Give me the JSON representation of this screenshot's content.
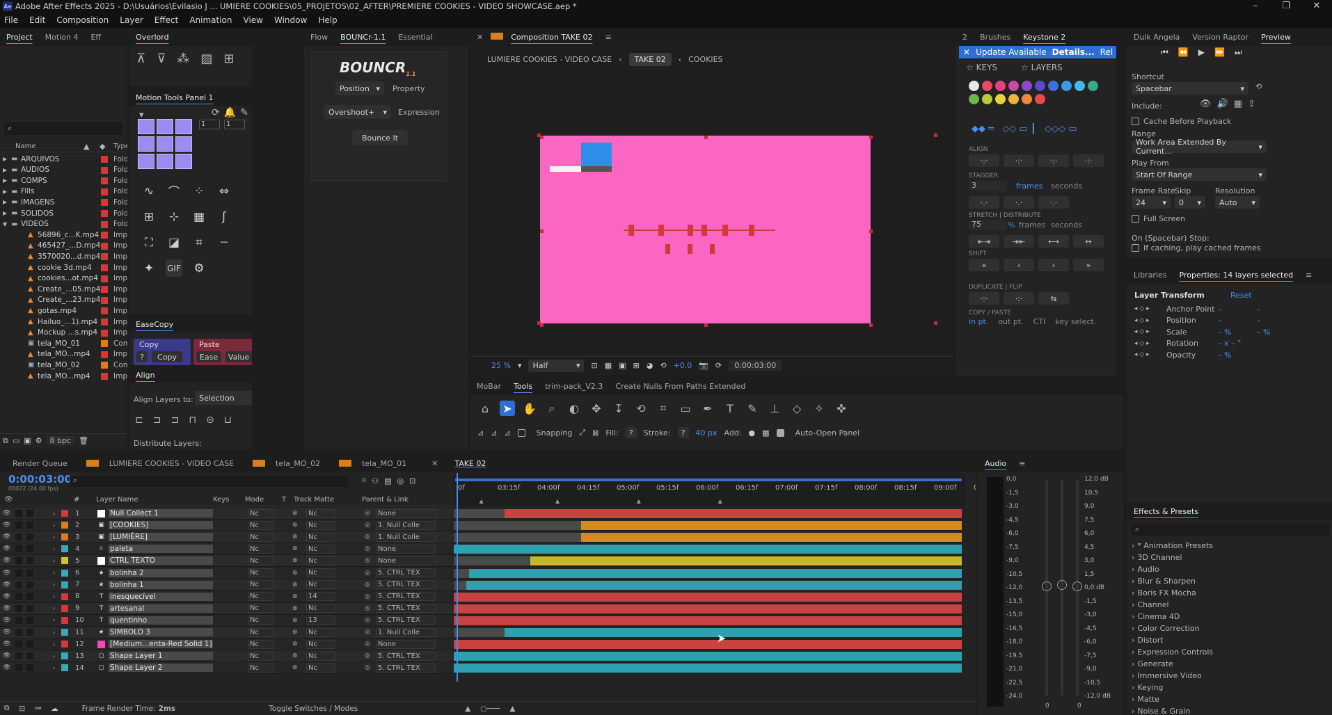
{
  "window": {
    "title": "Adobe After Effects 2025 - D:\\Usuários\\Evilasio J ... UMIERE COOKIES\\05_PROJETOS\\02_AFTER\\PREMIERE COOKIES - VIDEO SHOWCASE.aep *",
    "logo": "Ae"
  },
  "menu": [
    "File",
    "Edit",
    "Composition",
    "Layer",
    "Effect",
    "Animation",
    "View",
    "Window",
    "Help"
  ],
  "project": {
    "tabs": [
      "Project",
      "Motion 4",
      "Eff"
    ],
    "search_placeholder": "",
    "col_name": "Name",
    "col_type": "Type",
    "items": [
      {
        "name": "ARQUIVOS",
        "type": "Folder",
        "color": "#d23a3a",
        "icon": "folder-icon",
        "arrow": "▶"
      },
      {
        "name": "AUDIOS",
        "type": "Folder",
        "color": "#d23a3a",
        "icon": "folder-icon",
        "arrow": "▶"
      },
      {
        "name": "COMPS",
        "type": "Folder",
        "color": "#d23a3a",
        "icon": "folder-icon",
        "arrow": "▶"
      },
      {
        "name": "Fills",
        "type": "Folder",
        "color": "#d23a3a",
        "icon": "folder-icon",
        "arrow": "▶"
      },
      {
        "name": "IMAGENS",
        "type": "Folder",
        "color": "#d23a3a",
        "icon": "folder-icon",
        "arrow": "▶"
      },
      {
        "name": "SOLIDOS",
        "type": "Folder",
        "color": "#d23a3a",
        "icon": "folder-icon",
        "arrow": "▶"
      },
      {
        "name": "VIDEOS",
        "type": "Folder",
        "color": "#d23a3a",
        "icon": "folder-icon",
        "arrow": "▼"
      },
      {
        "name": "56896_c...K.mp4",
        "type": "Importe",
        "color": "#d23a3a",
        "icon": "cone-icon",
        "arrow": ""
      },
      {
        "name": "465427_...D.mp4",
        "type": "Importe",
        "color": "#d23a3a",
        "icon": "cone-icon",
        "arrow": ""
      },
      {
        "name": "3570020...d.mp4",
        "type": "Importe",
        "color": "#d23a3a",
        "icon": "cone-icon",
        "arrow": ""
      },
      {
        "name": "cookie 3d.mp4",
        "type": "Importe",
        "color": "#d23a3a",
        "icon": "cone-icon",
        "arrow": ""
      },
      {
        "name": "cookies...ot.mp4",
        "type": "Importe",
        "color": "#d23a3a",
        "icon": "cone-icon",
        "arrow": ""
      },
      {
        "name": "Create_...05.mp4",
        "type": "Importe",
        "color": "#d23a3a",
        "icon": "cone-icon",
        "arrow": ""
      },
      {
        "name": "Create_...23.mp4",
        "type": "Importe",
        "color": "#d23a3a",
        "icon": "cone-icon",
        "arrow": ""
      },
      {
        "name": "gotas.mp4",
        "type": "Importe",
        "color": "#d23a3a",
        "icon": "cone-icon",
        "arrow": ""
      },
      {
        "name": "Hailuo_...1).mp4",
        "type": "Importe",
        "color": "#d23a3a",
        "icon": "cone-icon",
        "arrow": ""
      },
      {
        "name": "Mockup ...s.mp4",
        "type": "Importe",
        "color": "#d23a3a",
        "icon": "cone-icon",
        "arrow": ""
      },
      {
        "name": "tela_MO_01",
        "type": "Compos",
        "color": "#d97e1a",
        "icon": "comp-icon",
        "arrow": ""
      },
      {
        "name": "tela_MO...mp4",
        "type": "Importe",
        "color": "#d23a3a",
        "icon": "cone-icon",
        "arrow": ""
      },
      {
        "name": "tela_MO_02",
        "type": "Compos",
        "color": "#d97e1a",
        "icon": "comp-icon",
        "arrow": ""
      },
      {
        "name": "tela_MO...mp4",
        "type": "Importe",
        "color": "#d23a3a",
        "icon": "cone-icon",
        "arrow": ""
      }
    ],
    "bpc": "8 bpc"
  },
  "overlord": {
    "title": "Overlord"
  },
  "motion_tools": {
    "title": "Motion Tools Panel 1",
    "num1": "1",
    "num2": "1",
    "gif": "GIF"
  },
  "easecopy": {
    "title": "EaseCopy",
    "copy": "Copy",
    "paste": "Paste",
    "q": "?",
    "copy_btn": "Copy",
    "ease": "Ease",
    "value": "Value"
  },
  "align": {
    "title": "Align",
    "align_to_label": "Align Layers to:",
    "align_to_value": "Selection",
    "distribute": "Distribute Layers:"
  },
  "bounce": {
    "tabs": [
      "Flow",
      "BOUNCr-1.1",
      "Essential"
    ],
    "logo": "BOUNCR",
    "logo_sub": "1.1",
    "position": "Position",
    "property": "Property",
    "overshoot": "Overshoot+",
    "expression": "Expression",
    "bounce_btn": "Bounce It"
  },
  "composition": {
    "tab": "Composition TAKE 02",
    "crumbs": [
      "LUMIERE COOKIES - VIDEO CASE",
      "TAKE 02",
      "COOKIES"
    ],
    "zoom": "25 %",
    "res": "Half",
    "exposure": "+0,0",
    "time": "0:00:03:00",
    "bg": "#fc66c3"
  },
  "keystone": {
    "tabs": [
      "2",
      "Brushes",
      "Keystone 2"
    ],
    "update": "Update Available",
    "details": "Details...",
    "rel": "Rel",
    "keys": "KEYS",
    "layers": "LAYERS",
    "align": "ALIGN",
    "stagger": "STAGGER",
    "stagger_val": "3",
    "frames": "frames",
    "seconds": "seconds",
    "stretch": "STRETCH",
    "distribute": "DISTRIBUTE",
    "stretch_val": "75",
    "pct": "%",
    "shift": "SHIFT",
    "duplicate": "DUPLICATE",
    "flip": "FLIP",
    "copy_paste": "COPY / PASTE",
    "inpt": "in pt.",
    "outpt": "out pt.",
    "cti": "CTI",
    "keysel": "key select.",
    "colors": [
      "#e8e8e8",
      "#e84a5f",
      "#e8417a",
      "#c94aa6",
      "#8a4ac9",
      "#5b4ad1",
      "#3a6fe0",
      "#3a9be8",
      "#4ab5e8",
      "#3aa88a",
      "#6ab84a",
      "#b8c93a",
      "#e8d43a",
      "#f0b43a",
      "#f08a3a",
      "#e84a4a"
    ]
  },
  "preview": {
    "tabs": [
      "Duik Angela",
      "Version Raptor",
      "Preview"
    ],
    "shortcut_label": "Shortcut",
    "shortcut": "Spacebar",
    "include": "Include:",
    "cache": "Cache Before Playback",
    "range_label": "Range",
    "range": "Work Area Extended By Current...",
    "playfrom_label": "Play From",
    "playfrom": "Start Of Range",
    "fr_label": "Frame Rate",
    "skip_label": "Skip",
    "res_label": "Resolution",
    "fr": "24",
    "skip": "0",
    "res": "Auto",
    "fullscreen": "Full Screen",
    "onstop": "On (Spacebar) Stop:",
    "ifcaching": "If caching, play cached frames"
  },
  "properties": {
    "tabs": [
      "Libraries",
      "Properties: 14 layers selected"
    ],
    "section": "Layer Transform",
    "reset": "Reset",
    "rows": [
      {
        "name": "Anchor Point",
        "v1": "–",
        "v2": "–"
      },
      {
        "name": "Position",
        "v1": "–",
        "v2": "–"
      },
      {
        "name": "Scale",
        "v1": "– %",
        "v2": "– %"
      },
      {
        "name": "Rotation",
        "v1": "– x – °",
        "v2": ""
      },
      {
        "name": "Opacity",
        "v1": "– %",
        "v2": ""
      }
    ]
  },
  "tools": {
    "tabs": [
      "MoBar",
      "Tools",
      "trim-pack_V2.3",
      "Create Nulls From Paths Extended"
    ],
    "snapping": "Snapping",
    "fill": "Fill:",
    "stroke": "Stroke:",
    "q": "?",
    "px": "40 px",
    "add": "Add:",
    "autoopen": "Auto-Open Panel"
  },
  "timeline": {
    "tabs": [
      "Render Queue",
      "LUMIERE COOKIES - VIDEO CASE",
      "tela_MO_02",
      "tela_MO_01",
      "TAKE 02"
    ],
    "tab_colors": [
      "",
      "#d97e1a",
      "#d97e1a",
      "#d97e1a",
      ""
    ],
    "time": "0:00:03:00",
    "time_sub": "00072 (24.00 fps)",
    "headers": {
      "num": "#",
      "name": "Layer Name",
      "keys": "Keys",
      "mode": "Mode",
      "t": "T",
      "matte": "Track Matte",
      "parent": "Parent & Link"
    },
    "ruler": [
      "0f",
      "03:15f",
      "04:00f",
      "04:15f",
      "05:00f",
      "05:15f",
      "06:00f",
      "06:15f",
      "07:00f",
      "07:15f",
      "08:00f",
      "08:15f",
      "09:00f",
      "0"
    ],
    "layers": [
      {
        "n": "1",
        "name": "Null Collect 1",
        "color": "#d23a3a",
        "sw": "#ffffff",
        "icon": "square",
        "mode": "Nc",
        "t": "",
        "matte": "Nc",
        "parent": "None",
        "bar": "#c94343",
        "bs": 0.1,
        "be": 1.0
      },
      {
        "n": "2",
        "name": "[COOKIES]",
        "color": "#d97e1a",
        "sw": "#d97e1a",
        "icon": "comp",
        "mode": "Nc",
        "t": "",
        "matte": "Nc",
        "parent": "1. Null Colle",
        "bar": "#d38a20",
        "bs": 0.25,
        "be": 1.0
      },
      {
        "n": "3",
        "name": "[LUMIÈRE]",
        "color": "#d97e1a",
        "sw": "#d97e1a",
        "icon": "comp",
        "mode": "Nc",
        "t": "",
        "matte": "Nc",
        "parent": "1. Null Colle",
        "bar": "#d38a20",
        "bs": 0.25,
        "be": 1.0
      },
      {
        "n": "4",
        "name": "paleta",
        "color": "#3aa8b8",
        "sw": "#3aa8b8",
        "icon": "null",
        "mode": "Nc",
        "t": "",
        "matte": "Nc",
        "parent": "None",
        "bar": "#2fa0b0",
        "bs": 0.0,
        "be": 1.0
      },
      {
        "n": "5",
        "name": "CTRL TEXTO",
        "color": "#d4c22a",
        "sw": "#ffffff",
        "icon": "square",
        "mode": "Nc",
        "t": "",
        "matte": "Nc",
        "parent": "None",
        "bar": "#c9b82a",
        "bs": 0.15,
        "be": 1.0
      },
      {
        "n": "6",
        "name": "bolinha 2",
        "color": "#3aa8b8",
        "sw": "#3aa8b8",
        "icon": "star",
        "mode": "Nc",
        "t": "",
        "matte": "Nc",
        "parent": "5. CTRL TEX",
        "bar": "#2fa0b0",
        "bs": 0.03,
        "be": 1.0
      },
      {
        "n": "7",
        "name": "bolinha 1",
        "color": "#3aa8b8",
        "sw": "#3aa8b8",
        "icon": "star",
        "mode": "Nc",
        "t": "",
        "matte": "Nc",
        "parent": "5. CTRL TEX",
        "bar": "#2fa0b0",
        "bs": 0.025,
        "be": 1.0
      },
      {
        "n": "8",
        "name": "inesquecível",
        "color": "#d23a3a",
        "sw": "#d23a3a",
        "icon": "text",
        "mode": "Nc",
        "t": "",
        "matte": "14",
        "parent": "5. CTRL TEX",
        "bar": "#c94343",
        "bs": 0.0,
        "be": 1.0
      },
      {
        "n": "9",
        "name": "artesanal",
        "color": "#d23a3a",
        "sw": "#d23a3a",
        "icon": "text",
        "mode": "Nc",
        "t": "",
        "matte": "Nc",
        "parent": "5. CTRL TEX",
        "bar": "#c94343",
        "bs": 0.0,
        "be": 1.0
      },
      {
        "n": "10",
        "name": "quentinho",
        "color": "#d23a3a",
        "sw": "#d23a3a",
        "icon": "text",
        "mode": "Nc",
        "t": "",
        "matte": "13",
        "parent": "5. CTRL TEX",
        "bar": "#c94343",
        "bs": 0.0,
        "be": 1.0
      },
      {
        "n": "11",
        "name": "SIMBOLO 3",
        "color": "#3aa8b8",
        "sw": "#3aa8b8",
        "icon": "star",
        "mode": "Nc",
        "t": "",
        "matte": "Nc",
        "parent": "1. Null Colle",
        "bar": "#2fa0b0",
        "bs": 0.1,
        "be": 1.0
      },
      {
        "n": "12",
        "name": "[Medium...enta-Red Solid 1]",
        "color": "#d23a3a",
        "sw": "#ff44bb",
        "icon": "square",
        "mode": "Nc",
        "t": "",
        "matte": "Nc",
        "parent": "None",
        "bar": "#c94343",
        "bs": 0.0,
        "be": 1.0
      },
      {
        "n": "13",
        "name": "Shape Layer 1",
        "color": "#3aa8b8",
        "sw": "#3aa8b8",
        "icon": "shape",
        "mode": "Nc",
        "t": "",
        "matte": "Nc",
        "parent": "5. CTRL TEX",
        "bar": "#2fa0b0",
        "bs": 0.0,
        "be": 1.0
      },
      {
        "n": "14",
        "name": "Shape Layer 2",
        "color": "#3aa8b8",
        "sw": "#3aa8b8",
        "icon": "shape",
        "mode": "Nc",
        "t": "",
        "matte": "Nc",
        "parent": "5. CTRL TEX",
        "bar": "#2fa0b0",
        "bs": 0.0,
        "be": 1.0
      }
    ],
    "frame_render": "Frame Render Time:",
    "frame_render_val": "2ms",
    "toggle": "Toggle Switches / Modes"
  },
  "audio": {
    "title": "Audio",
    "left": [
      "0,0",
      "-1,5",
      "-3,0",
      "-4,5",
      "-6,0",
      "-7,5",
      "-9,0",
      "-10,5",
      "-12,0",
      "-13,5",
      "-15,0",
      "-16,5",
      "-18,0",
      "-19,5",
      "-21,0",
      "-22,5",
      "-24,0"
    ],
    "right": [
      "12,0 dB",
      "10,5",
      "9,0",
      "7,5",
      "6,0",
      "4,5",
      "3,0",
      "1,5",
      "0,0 dB",
      "-1,5",
      "-3,0",
      "-4,5",
      "-6,0",
      "-7,5",
      "-9,0",
      "-10,5",
      "-12,0 dB"
    ],
    "bottom": [
      "0",
      "0"
    ]
  },
  "effects": {
    "title": "Effects & Presets",
    "items": [
      "* Animation Presets",
      "3D Channel",
      "Audio",
      "Blur & Sharpen",
      "Boris FX Mocha",
      "Channel",
      "Cinema 4D",
      "Color Correction",
      "Distort",
      "Expression Controls",
      "Generate",
      "Immersive Video",
      "Keying",
      "Matte",
      "Noise & Grain"
    ]
  }
}
